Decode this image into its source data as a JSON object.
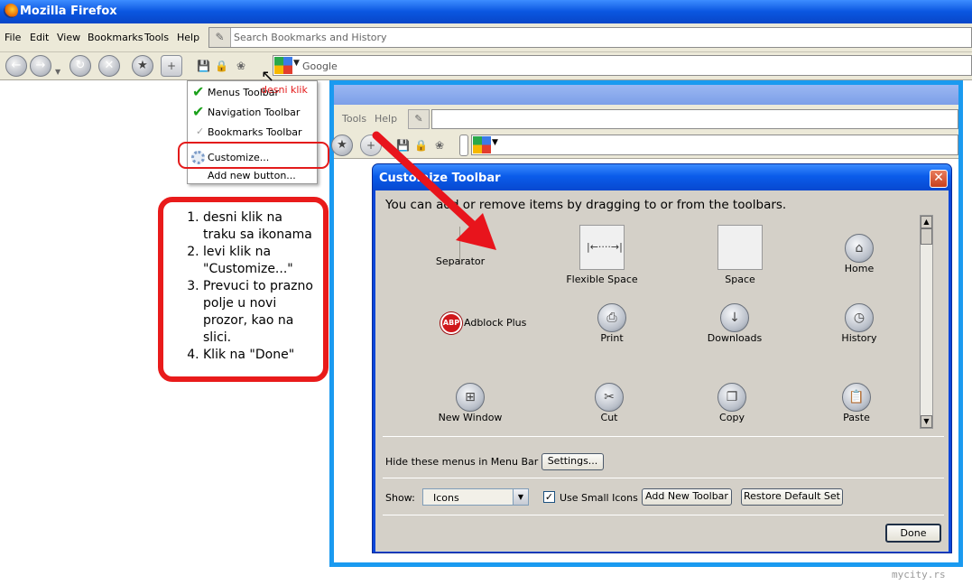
{
  "window": {
    "title": "Mozilla Firefox"
  },
  "menubar": {
    "items": [
      "File",
      "Edit",
      "View",
      "Bookmarks",
      "Tools",
      "Help"
    ],
    "search_placeholder": "Search Bookmarks and History"
  },
  "navbar": {
    "search_engine": "Google"
  },
  "context_menu": {
    "items": [
      {
        "label": "Menus Toolbar",
        "checked": true
      },
      {
        "label": "Navigation Toolbar",
        "checked": true
      },
      {
        "label": "Bookmarks Toolbar",
        "checked": false
      },
      {
        "label": "Customize...",
        "checked": false
      },
      {
        "label": "Add new button...",
        "checked": false
      }
    ],
    "annotation": "desni klik"
  },
  "instructions": {
    "steps": [
      "desni klik na traku sa ikonama",
      "levi klik na \"Customize...\"",
      "Prevuci to prazno polje u novi prozor, kao na slici.",
      "Klik na \"Done\""
    ]
  },
  "inner_window": {
    "menu_items": [
      "Tools",
      "Help"
    ]
  },
  "dialog": {
    "title": "Customize Toolbar",
    "close_label": "✕",
    "instruction": "You can add or remove items by dragging to or from the toolbars.",
    "palette": [
      {
        "label": "Separator",
        "icon": "separator-icon"
      },
      {
        "label": "Flexible Space",
        "icon": "flexible-space-icon"
      },
      {
        "label": "Space",
        "icon": "space-icon"
      },
      {
        "label": "Home",
        "icon": "home-icon"
      },
      {
        "label": "Adblock Plus",
        "icon": "abp-icon"
      },
      {
        "label": "Print",
        "icon": "print-icon"
      },
      {
        "label": "Downloads",
        "icon": "downloads-icon"
      },
      {
        "label": "History",
        "icon": "history-icon"
      },
      {
        "label": "New Window",
        "icon": "new-window-icon"
      },
      {
        "label": "Cut",
        "icon": "cut-icon"
      },
      {
        "label": "Copy",
        "icon": "copy-icon"
      },
      {
        "label": "Paste",
        "icon": "paste-icon"
      }
    ],
    "hide_menus_label": "Hide these menus in Menu Bar",
    "settings_button": "Settings...",
    "show_label": "Show:",
    "show_value": "Icons",
    "small_icons_label": "Use Small Icons",
    "small_icons_checked": true,
    "add_toolbar_button": "Add New Toolbar",
    "restore_button": "Restore Default Set",
    "done_button": "Done",
    "abp_badge": "ABP"
  },
  "watermark": "mycity.rs",
  "colors": {
    "annotation_red": "#e31b1b",
    "frame_blue": "#1a9af0",
    "xp_title_blue": "#0a56e0"
  }
}
